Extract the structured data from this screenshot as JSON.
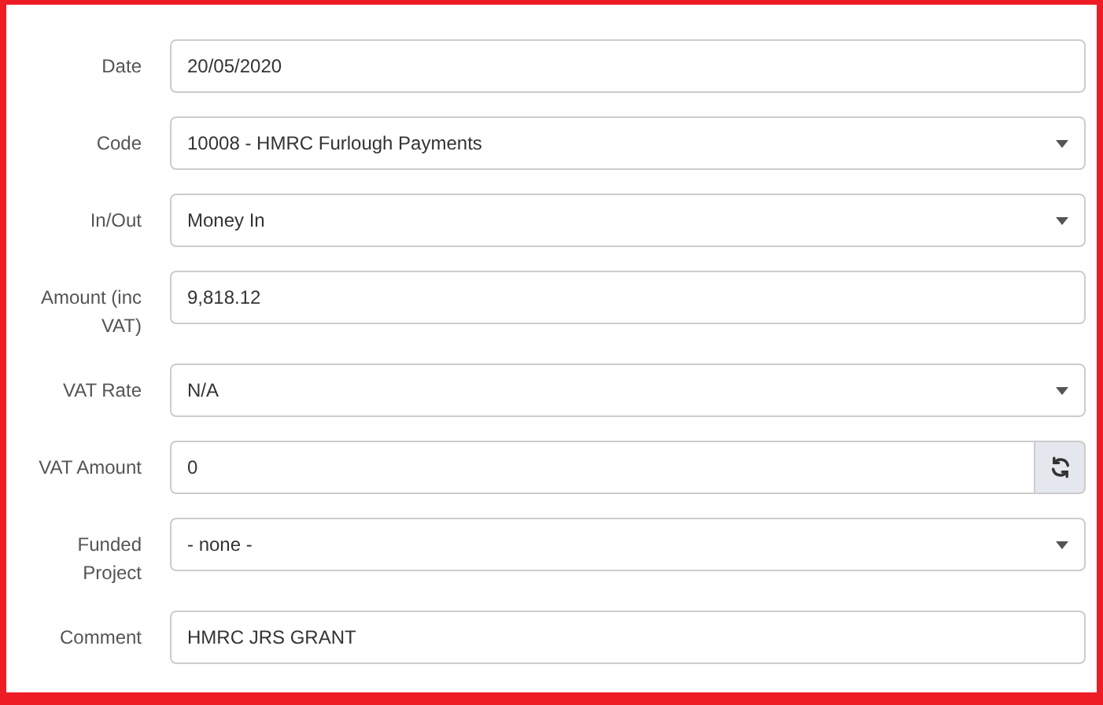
{
  "fields": [
    {
      "label": "Date",
      "kind": "text",
      "value": "20/05/2020"
    },
    {
      "label": "Code",
      "kind": "select",
      "value": "10008 - HMRC Furlough Payments"
    },
    {
      "label": "In/Out",
      "kind": "select",
      "value": "Money In"
    },
    {
      "label": "Amount (inc VAT)",
      "kind": "text",
      "value": "9,818.12"
    },
    {
      "label": "VAT Rate",
      "kind": "select",
      "value": "N/A"
    },
    {
      "label": "VAT Amount",
      "kind": "refresh",
      "value": "0"
    },
    {
      "label": "Funded Project",
      "kind": "select",
      "value": "- none -"
    },
    {
      "label": "Comment",
      "kind": "text",
      "value": "HMRC JRS GRANT"
    }
  ]
}
